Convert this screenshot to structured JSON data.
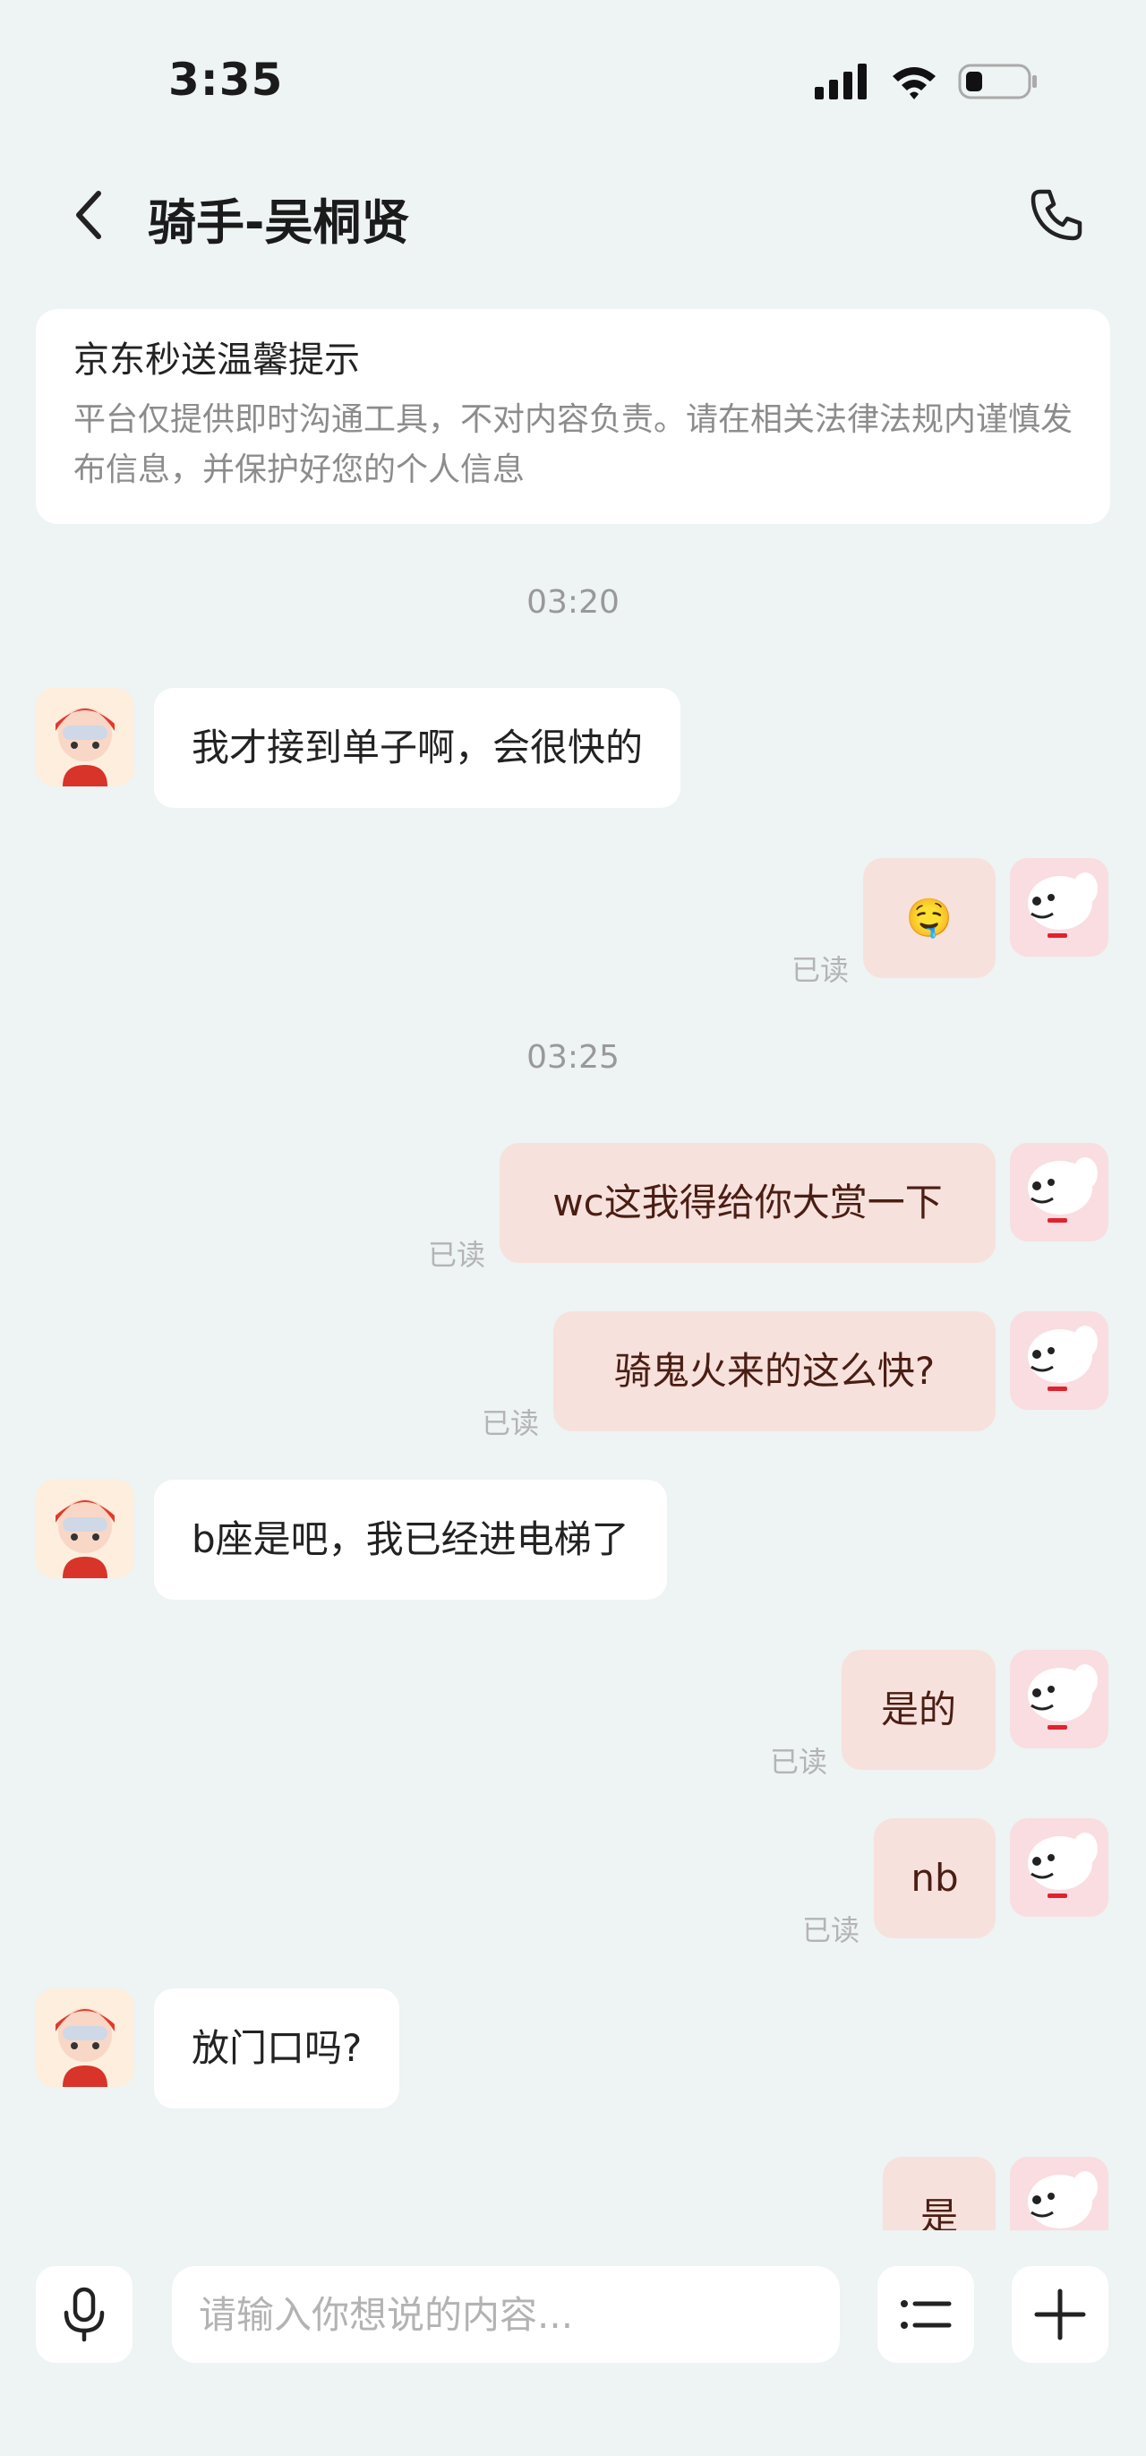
{
  "status": {
    "time": "3:35"
  },
  "nav": {
    "title": "骑手-吴桐贤"
  },
  "tip": {
    "title": "京东秒送温馨提示",
    "body": "平台仅提供即时沟通工具，不对内容负责。请在相关法律法规内谨慎发布信息，并保护好您的个人信息"
  },
  "time_separators": [
    "03:20",
    "03:25"
  ],
  "messages": [
    {
      "from": "rider",
      "text": "我才接到单子啊，会很快的"
    },
    {
      "from": "me",
      "text": "🤤",
      "status": "已读"
    },
    {
      "from": "me",
      "text": "wc这我得给你大赏一下",
      "status": "已读"
    },
    {
      "from": "me",
      "text": "骑鬼火来的这么快?",
      "status": "已读"
    },
    {
      "from": "rider",
      "text": "b座是吧，我已经进电梯了"
    },
    {
      "from": "me",
      "text": "是的",
      "status": "已读"
    },
    {
      "from": "me",
      "text": "nb",
      "status": "已读"
    },
    {
      "from": "rider",
      "text": "放门口吗?"
    },
    {
      "from": "me",
      "text": "是"
    }
  ],
  "input": {
    "placeholder": "请输入你想说的内容..."
  },
  "icons": {
    "back": "chevron-left-icon",
    "call": "phone-icon",
    "voice": "microphone-icon",
    "quick_reply": "list-icon",
    "more": "plus-icon"
  },
  "colors": {
    "background": "#eef3f3",
    "my_bubble": "#f7e1dc",
    "my_text": "#4a1e14",
    "their_bubble": "#ffffff",
    "read_label": "#b4b4b4"
  }
}
